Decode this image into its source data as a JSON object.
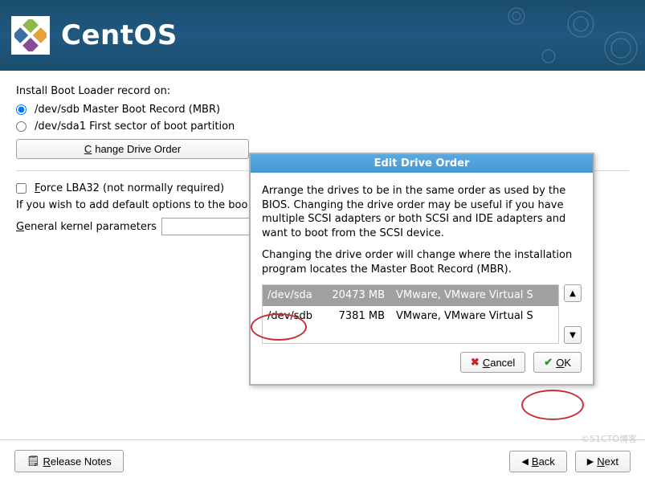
{
  "brand": "CentOS",
  "main": {
    "install_label": "Install Boot Loader record on:",
    "radio_mbr": "/dev/sdb Master Boot Record (MBR)",
    "radio_first": "/dev/sda1 First sector of boot partition",
    "change_order_btn_pre": "C",
    "change_order_btn_rest": "hange Drive Order",
    "force_lba_pre": "F",
    "force_lba_rest": "orce LBA32 (not normally required)",
    "kernel_hint": "If you wish to add default options to the boot command, enter them into the 'General kernel parameters' field.",
    "kernel_hint_visible": "If you wish to add default options to the boo",
    "kernel_input_pre": "G",
    "kernel_input_rest": "eneral kernel parameters",
    "kernel_value": ""
  },
  "dialog": {
    "title": "Edit Drive Order",
    "para1": "Arrange the drives to be in the same order as used by the BIOS. Changing the drive order may be useful if you have multiple SCSI adapters or both SCSI and IDE adapters and want to boot from the SCSI device.",
    "para2": "Changing the drive order will change where the installation program locates the Master Boot Record (MBR).",
    "rows": [
      {
        "dev": "/dev/sda",
        "size": "20473 MB",
        "desc": "VMware, VMware Virtual S"
      },
      {
        "dev": "/dev/sdb",
        "size": "7381 MB",
        "desc": "VMware, VMware Virtual S"
      }
    ],
    "cancel_pre": "C",
    "cancel_rest": "ancel",
    "ok_pre": "O",
    "ok_rest": "K"
  },
  "footer": {
    "release_pre": "R",
    "release_rest": "elease Notes",
    "back_pre": "B",
    "back_rest": "ack",
    "next_pre": "N",
    "next_rest": "ext"
  },
  "icons": {
    "up": "▲",
    "down": "▼",
    "x": "✖",
    "ok": "✔",
    "note": "🗒",
    "back_arrow": "◀",
    "next_arrow": "▶"
  },
  "watermark": "©51CTO博客",
  "trailing_dot": "."
}
